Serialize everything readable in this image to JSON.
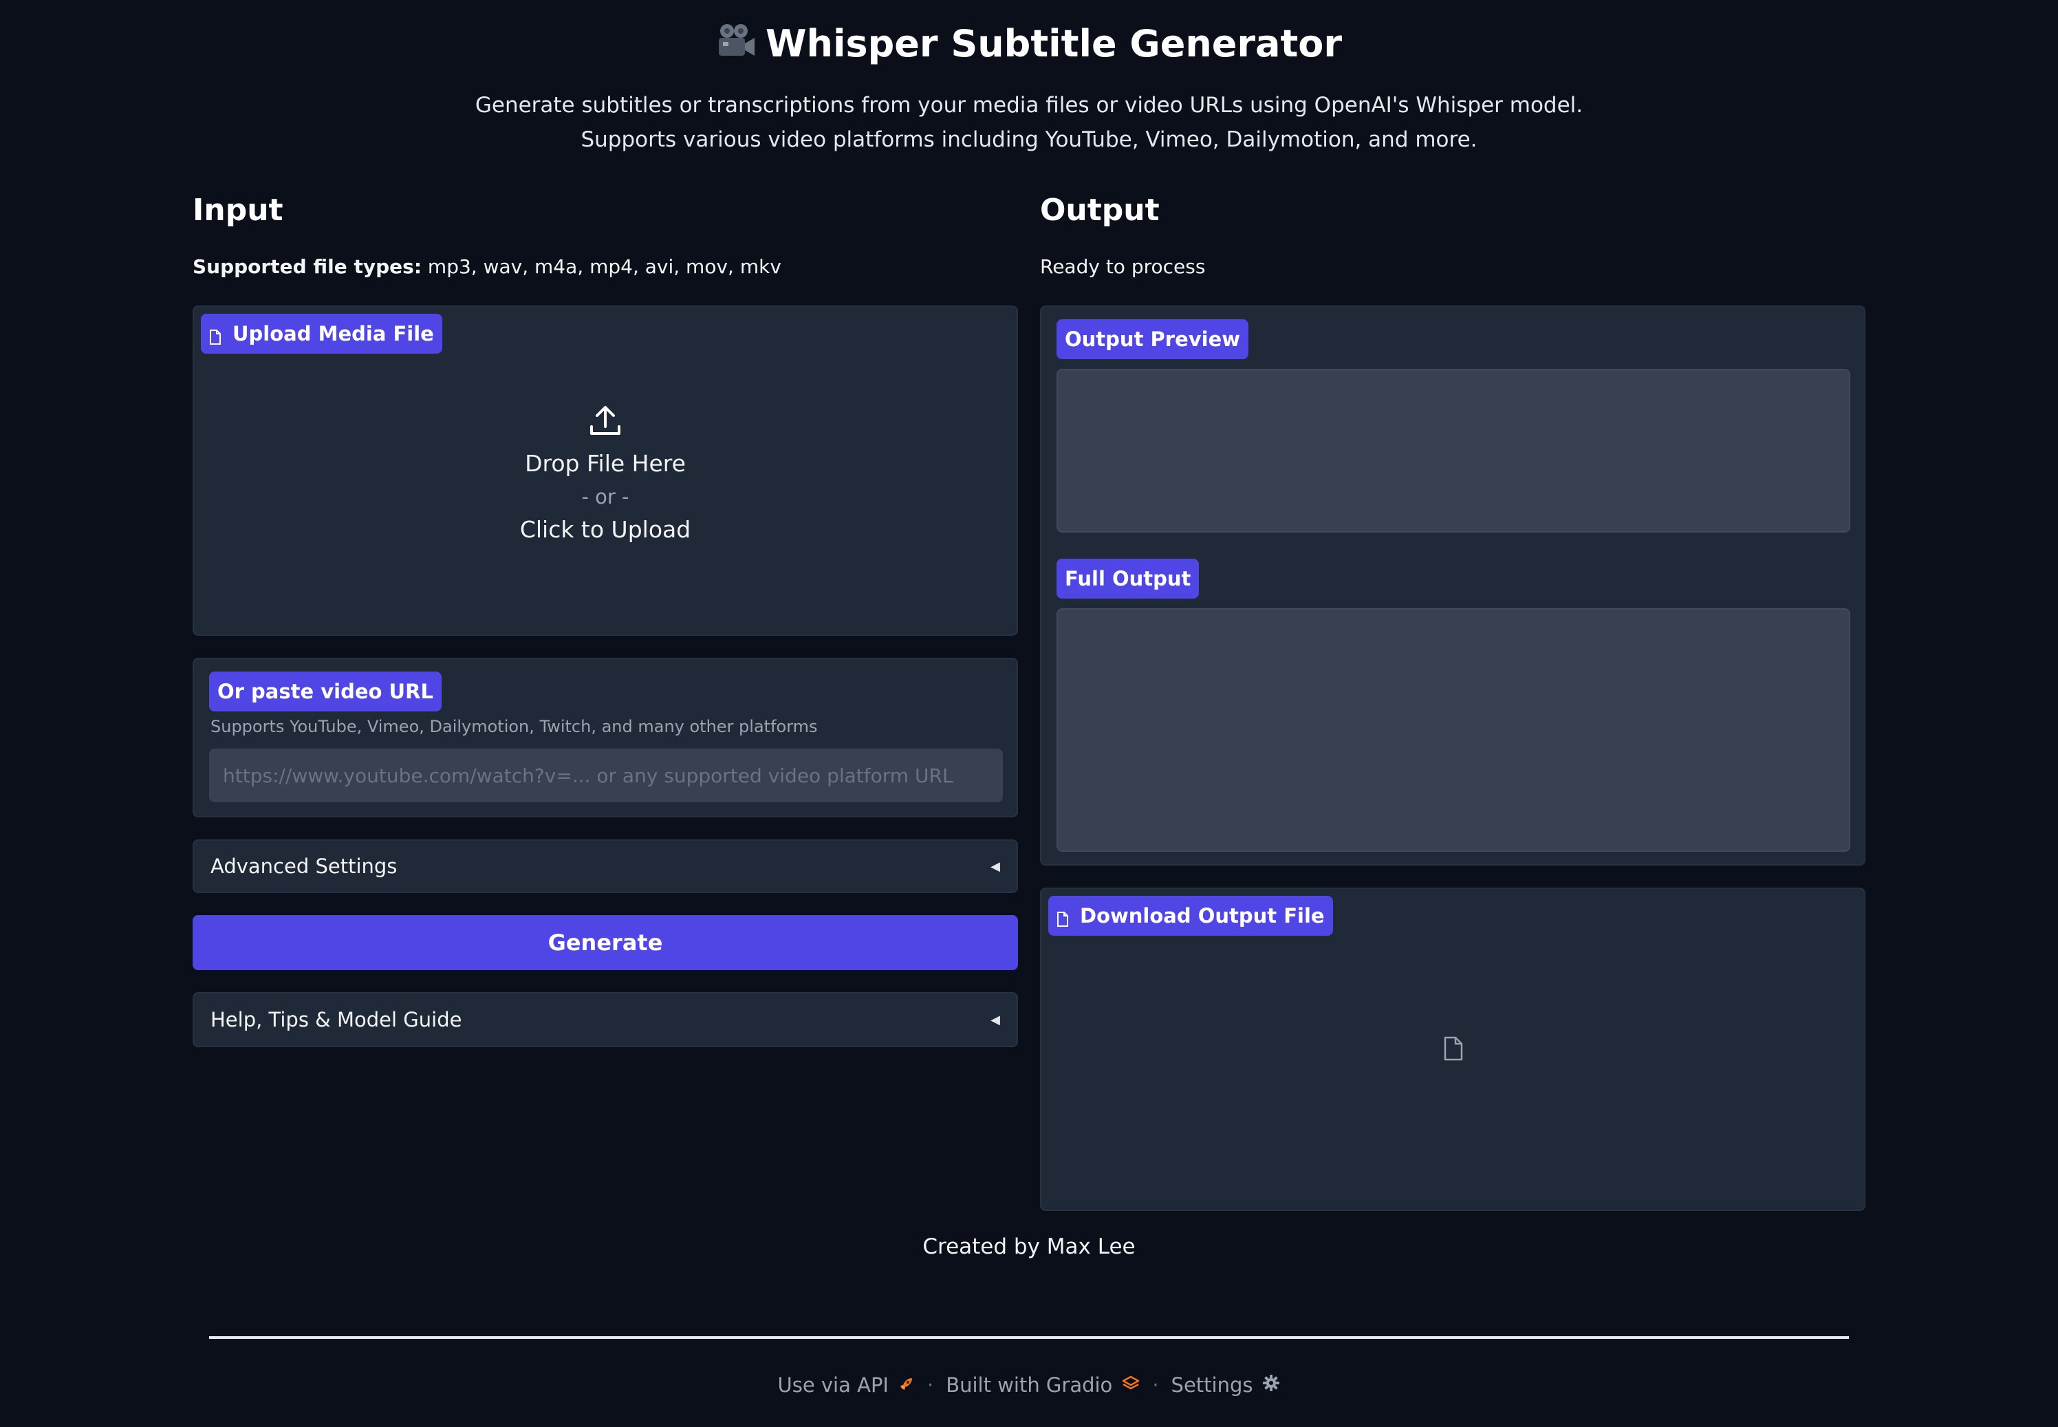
{
  "header": {
    "title": "Whisper Subtitle Generator",
    "title_icon": "movie-camera-icon",
    "description_line1": "Generate subtitles or transcriptions from your media files or video URLs using OpenAI's Whisper model.",
    "description_line2": "Supports various video platforms including YouTube, Vimeo, Dailymotion, and more."
  },
  "input": {
    "heading": "Input",
    "filetypes_label": "Supported file types:",
    "filetypes_value": " mp3, wav, m4a, mp4, avi, mov, mkv",
    "upload": {
      "label": "Upload Media File",
      "drop_text": "Drop File Here",
      "or_text": "- or -",
      "click_text": "Click to Upload"
    },
    "url": {
      "label": "Or paste video URL",
      "info": "Supports YouTube, Vimeo, Dailymotion, Twitch, and many other platforms",
      "placeholder": "https://www.youtube.com/watch?v=... or any supported video platform URL",
      "value": ""
    },
    "advanced_settings": "Advanced Settings",
    "generate": "Generate",
    "help": "Help, Tips & Model Guide"
  },
  "output": {
    "heading": "Output",
    "status": "Ready to process",
    "preview_label": "Output Preview",
    "full_label": "Full Output",
    "download_label": "Download Output File"
  },
  "footer": {
    "credit": "Created by Max Lee",
    "links": [
      {
        "label": "Use via API",
        "icon": "rocket-icon"
      },
      {
        "label": "Built with Gradio",
        "icon": "gradio-logo-icon"
      },
      {
        "label": "Settings",
        "icon": "gear-icon"
      }
    ],
    "separator": "·"
  },
  "colors": {
    "background": "#0b0f19",
    "panel": "#1f2937",
    "accent": "#4f46e5",
    "textarea": "#374151"
  }
}
